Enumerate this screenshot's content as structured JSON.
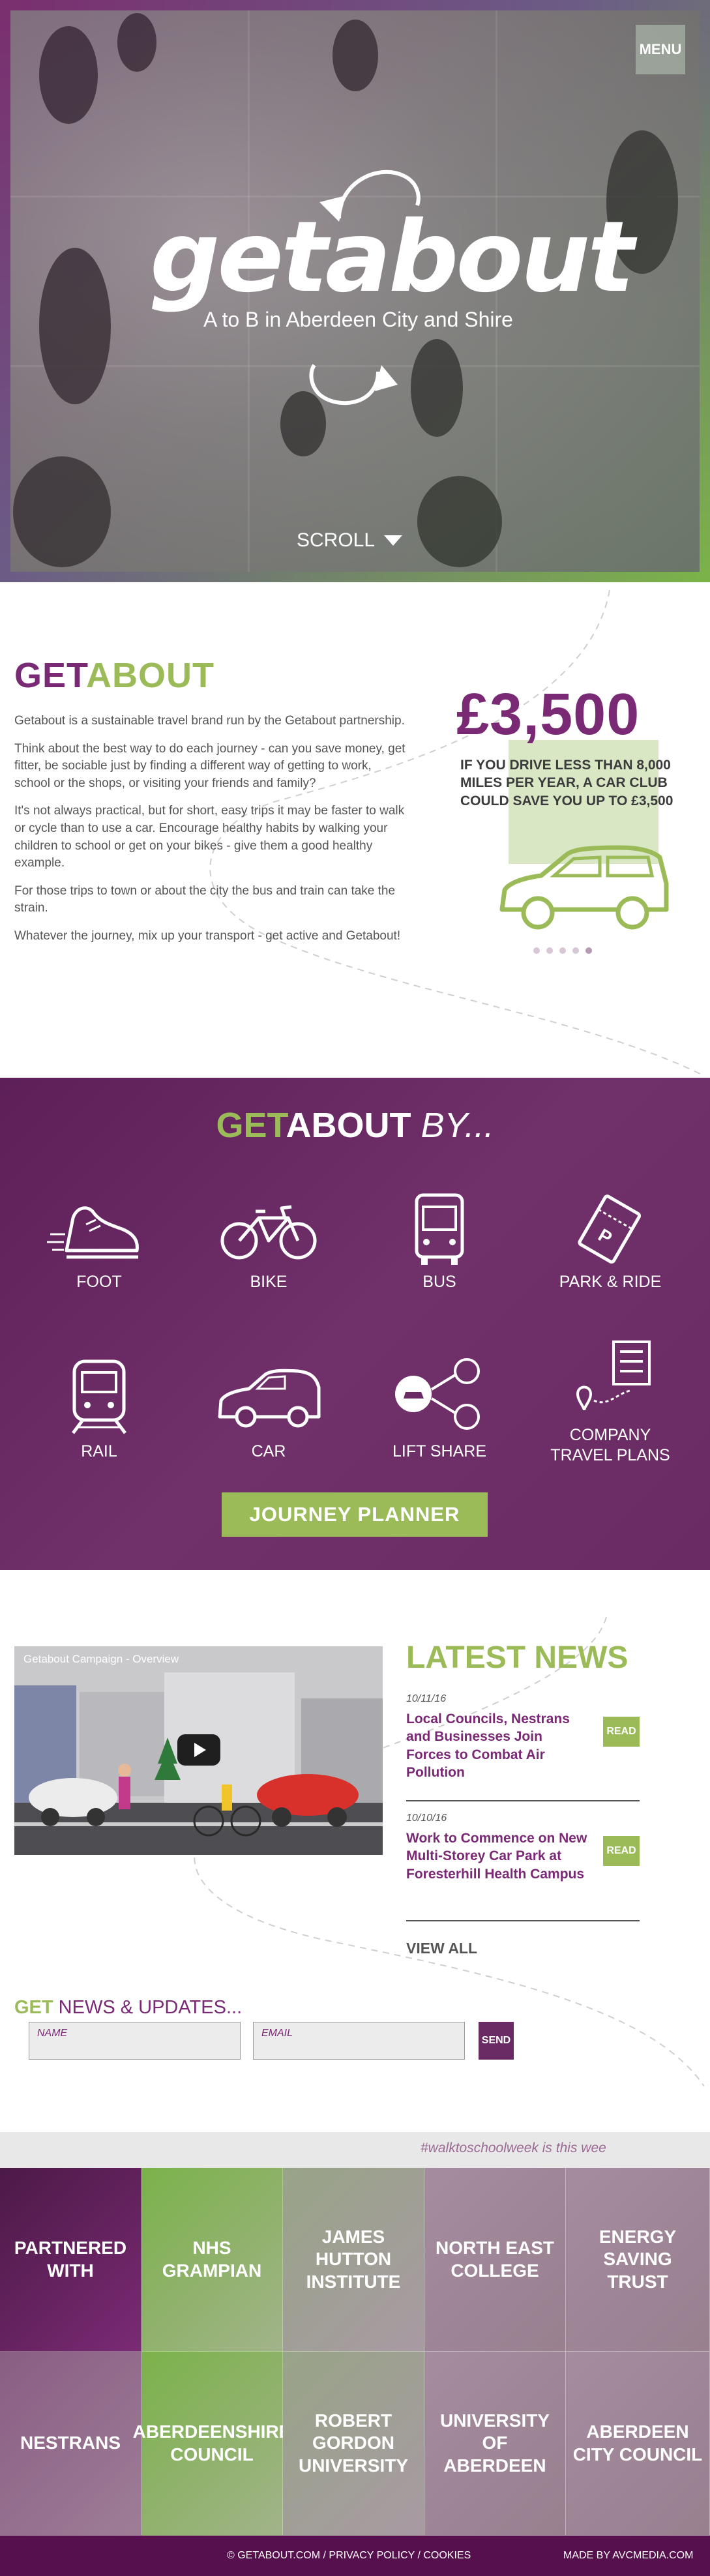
{
  "header": {
    "menu_label": "MENU",
    "logo_word": "getabout",
    "tagline": "A to B in Aberdeen City and Shire",
    "scroll_label": "SCROLL"
  },
  "intro": {
    "title_part1": "GET",
    "title_part2": "ABOUT",
    "paragraphs": [
      "Getabout is a sustainable travel brand run by the Getabout partnership.",
      "Think about the best way to do each journey - can you save money, get fitter, be sociable just by finding a different way of getting to work, school or the shops, or visiting your friends and family?",
      "It's not always practical, but for short, easy trips it may be faster to walk or cycle than to use a car. Encourage healthy habits by walking your children to school or get on your bikes - give them a good healthy example.",
      "For those trips to town or about the city the bus and train can take the strain.",
      "Whatever the journey, mix up your transport - get active and Getabout!"
    ],
    "stat_amount": "£3,500",
    "stat_text": "IF YOU DRIVE LESS THAN 8,000 MILES PER YEAR, A CAR CLUB COULD SAVE YOU UP TO £3,500"
  },
  "by_section": {
    "title_get": "GET",
    "title_about": "ABOUT",
    "title_by": "BY...",
    "modes": [
      {
        "label": "FOOT",
        "icon": "shoe-icon"
      },
      {
        "label": "BIKE",
        "icon": "bicycle-icon"
      },
      {
        "label": "BUS",
        "icon": "bus-icon"
      },
      {
        "label": "PARK & RIDE",
        "icon": "ticket-icon"
      },
      {
        "label": "RAIL",
        "icon": "train-icon"
      },
      {
        "label": "CAR",
        "icon": "car-icon"
      },
      {
        "label": "LIFT SHARE",
        "icon": "liftshare-icon"
      },
      {
        "label": "COMPANY TRAVEL PLANS",
        "icon": "office-building-icon"
      }
    ],
    "journey_planner_label": "JOURNEY PLANNER"
  },
  "video": {
    "title": "Getabout Campaign - Overview"
  },
  "news": {
    "title": "LATEST NEWS",
    "items": [
      {
        "date": "10/11/16",
        "headline": "Local Councils, Nestrans and Businesses Join Forces to Combat Air Pollution",
        "read_label": "READ"
      },
      {
        "date": "10/10/16",
        "headline": "Work to Commence on New Multi-Storey Car Park at Foresterhill Health Campus",
        "read_label": "READ"
      }
    ],
    "view_all_label": "VIEW ALL"
  },
  "signup": {
    "title_get": "GET",
    "title_rest": " NEWS & UPDATES...",
    "name_label": "NAME",
    "email_label": "EMAIL",
    "send_label": "SEND"
  },
  "ticker": {
    "text": "#walktoschoolweek is this wee"
  },
  "partners": {
    "heading": "PARTNERED WITH",
    "names": [
      "NHS GRAMPIAN",
      "JAMES HUTTON INSTITUTE",
      "NORTH EAST COLLEGE",
      "ENERGY SAVING TRUST",
      "NESTRANS",
      "ABERDEENSHIRE COUNCIL",
      "ROBERT GORDON UNIVERSITY",
      "UNIVERSITY OF ABERDEEN",
      "ABERDEEN CITY COUNCIL"
    ]
  },
  "footer": {
    "copyright": "© GETABOUT.COM",
    "sep1": " / ",
    "privacy": "PRIVACY POLICY",
    "sep2": " / ",
    "cookies": "COOKIES",
    "made_by": "MADE BY AVCMEDIA.COM"
  },
  "colors": {
    "purple": "#7a2a74",
    "dark_purple": "#55104d",
    "green": "#9bbb59"
  }
}
